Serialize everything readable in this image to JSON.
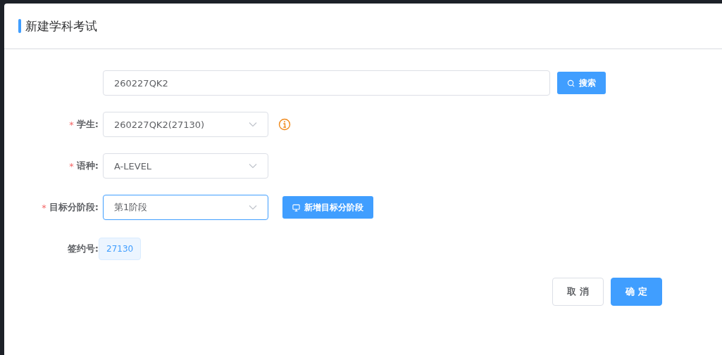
{
  "dialog": {
    "title": "新建学科考试"
  },
  "search": {
    "value": "260227QK2",
    "button": "搜索"
  },
  "required_mark": "*",
  "fields": [
    {
      "kind": "select",
      "label": "学生:",
      "required": true,
      "value": "260227QK2(27130)",
      "focused": false,
      "info": true
    },
    {
      "kind": "select",
      "label": "语种:",
      "required": true,
      "value": "A-LEVEL",
      "focused": false,
      "info": false
    },
    {
      "kind": "select",
      "label": "目标分阶段:",
      "required": true,
      "value": "第1阶段",
      "focused": true,
      "info": false,
      "action": "新增目标分阶段"
    },
    {
      "kind": "tag",
      "label": "签约号:",
      "required": false,
      "value": "27130",
      "info": false
    }
  ],
  "buttons": [
    {
      "label": "取 消",
      "kind": "secondary"
    },
    {
      "label": "确 定",
      "kind": "primary"
    }
  ]
}
